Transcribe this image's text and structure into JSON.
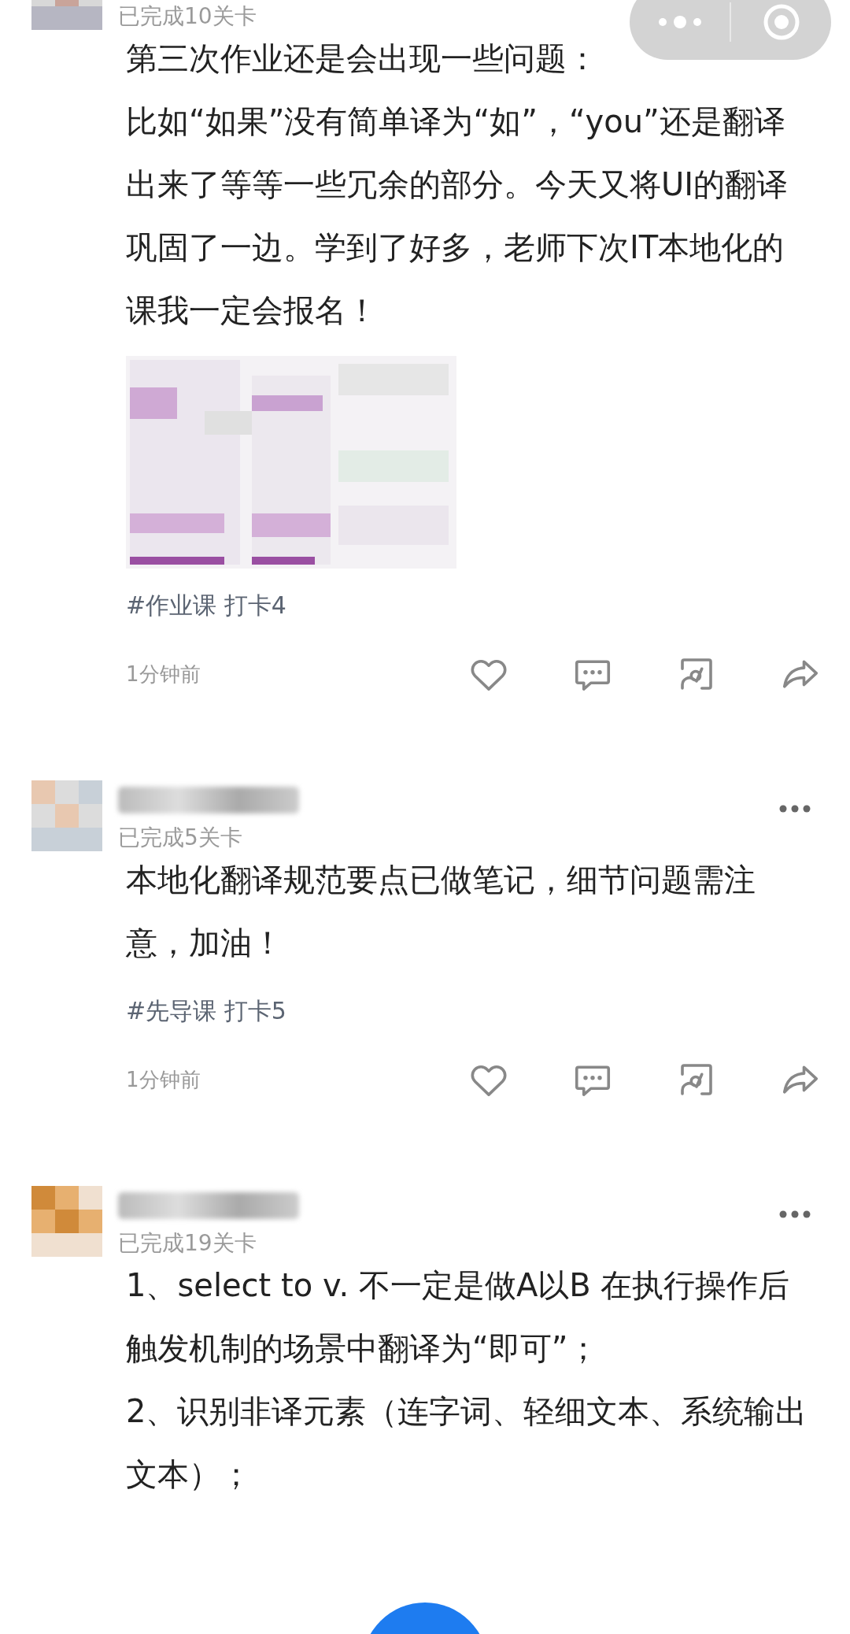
{
  "posts": [
    {
      "status": "已完成10关卡",
      "paragraphs": [
        "第三次作业还是会出现一些问题：",
        "比如“如果”没有简单译为“如”，“you”还是翻译出来了等等一些冗余的部分。今天又将UI的翻译巩固了一边。学到了好多，老师下次IT本地化的课我一定会报名！"
      ],
      "image": {
        "kind": "picture"
      },
      "tag": "#作业课 打卡4",
      "time": "1分钟前"
    },
    {
      "status": "已完成5关卡",
      "paragraphs": [
        "本地化翻译规范要点已做笔记，细节问题需注意，加油！"
      ],
      "tag": "#先导课 打卡5",
      "time": "1分钟前"
    },
    {
      "status": "已完成19关卡",
      "paragraphs": [
        "1、select to v. 不一定是做A以B 在执行操作后触发机制的场景中翻译为“即可”；",
        "2、识别非译元素（连字词、轻细文本、系统输出文本）；"
      ]
    }
  ]
}
